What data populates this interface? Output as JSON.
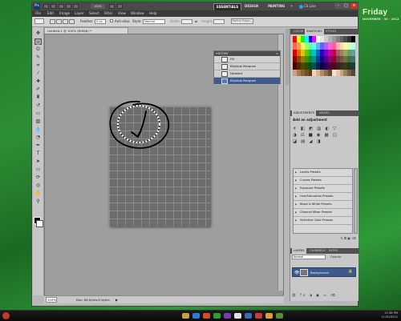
{
  "desktop": {
    "day": "Friday",
    "date": "NOVEMBER · 30 · 2012"
  },
  "titlebar": {
    "logo": "Ps",
    "zoom": "100%",
    "workspaces": [
      "ESSENTIALS",
      "DESIGN",
      "PAINTING"
    ],
    "more": "»",
    "cslive": "CS Live",
    "win_buttons": [
      "–",
      "□",
      "×"
    ]
  },
  "menu": [
    "File",
    "Edit",
    "Image",
    "Layer",
    "Select",
    "Filter",
    "View",
    "Window",
    "Help"
  ],
  "options": {
    "feather_label": "Feather:",
    "feather_value": "0 px",
    "antialias_label": "Anti-alias",
    "style_label": "Style:",
    "style_value": "Normal",
    "width_label": "Width:",
    "height_label": "Height:",
    "refine_button": "Refine Edge..."
  },
  "document": {
    "tab_title": "Untitled-1 @ 100% (RGB/8) *",
    "status_zoom": "100%",
    "status_doc": "Doc: 88 bytes/0 bytes",
    "status_arrow": "▶"
  },
  "history": {
    "title": "HISTORY",
    "menu": "≡",
    "rows": [
      "Fill",
      "Elliptical Marquee",
      "Deselect",
      "Elliptical Marquee"
    ]
  },
  "swatches_panel": {
    "tabs": [
      "COLOR",
      "SWATCHES",
      "STYLES"
    ],
    "colors": [
      "#ff0000",
      "#ffff00",
      "#00ff00",
      "#00ffff",
      "#0000ff",
      "#ff00ff",
      "#ffffff",
      "#e6e6e6",
      "#cccccc",
      "#b3b3b3",
      "#999999",
      "#808080",
      "#666666",
      "#4d4d4d",
      "#333333",
      "#000000",
      "#ff6060",
      "#ff9b40",
      "#fff070",
      "#a3ff5f",
      "#5fff9a",
      "#5ffff5",
      "#5fb0ff",
      "#6a60ff",
      "#b060ff",
      "#ff60e0",
      "#ff6090",
      "#ffb0b0",
      "#ffd8a8",
      "#fff5b0",
      "#d8ffb0",
      "#b0ffe8",
      "#e00000",
      "#e06a00",
      "#e0c400",
      "#6ac400",
      "#00c46a",
      "#00c4c4",
      "#006ac4",
      "#2a00c4",
      "#7a00c4",
      "#c400a0",
      "#c40050",
      "#a06060",
      "#a08060",
      "#a0a060",
      "#60a060",
      "#60a0a0",
      "#900000",
      "#904400",
      "#907e00",
      "#449000",
      "#009044",
      "#009090",
      "#004490",
      "#1c0090",
      "#500090",
      "#900070",
      "#900034",
      "#704040",
      "#705840",
      "#707040",
      "#407040",
      "#407070",
      "#500000",
      "#502600",
      "#504600",
      "#265000",
      "#005026",
      "#005050",
      "#002650",
      "#0f0050",
      "#2c0050",
      "#50003e",
      "#50001c",
      "#3a2020",
      "#3a2e20",
      "#3a3a20",
      "#203a20",
      "#203a3a",
      "#c9a27a",
      "#a67c52",
      "#8c6239",
      "#754c24",
      "#603913",
      "#ebd5b3",
      "#d9b38c",
      "#b38b5d",
      "#8e6d4a",
      "#6b4f33",
      "#f2e3c9",
      "#e0c9a6",
      "#c7a680",
      "#9e7f5c",
      "#785f44",
      "#5a4632"
    ]
  },
  "adjustments": {
    "tabs": [
      "ADJUSTMENTS",
      "MASKS"
    ],
    "title": "Add an adjustment",
    "icon_row1": "☀ ◧ ◩ ▥ ◐ ▽",
    "icon_row2": "◑ ⚖ ■ ◉ ▦ ◫",
    "icon_row3": "◪ ▤ ◢ ◨",
    "presets": [
      "Levels Presets",
      "Curves Presets",
      "Exposure Presets",
      "Hue/Saturation Presets",
      "Black & White Presets",
      "Channel Mixer Presets",
      "Selective Color Presets"
    ],
    "footer_icons": "↻ ⧉ ▣ ⌫"
  },
  "layers": {
    "tabs": [
      "LAYERS",
      "CHANNELS",
      "PATHS"
    ],
    "blend_mode": "Normal",
    "opacity_label": "Opacity:",
    "eye": "👁",
    "layer_name": "Background",
    "lock": "🔒",
    "footer_icons": "⛓ fx ◑ ▣ ▭ ⌫"
  },
  "taskbar": {
    "time": "11:58 PM",
    "date": "11/30/2012",
    "icon_colors": [
      "#c8a23a",
      "#2f7bd4",
      "#d94a2a",
      "#2e9e3a",
      "#7a3aa8",
      "#e0e0e0",
      "#3a6ab8",
      "#c83a3a",
      "#dba030",
      "#5a8a3a"
    ]
  }
}
